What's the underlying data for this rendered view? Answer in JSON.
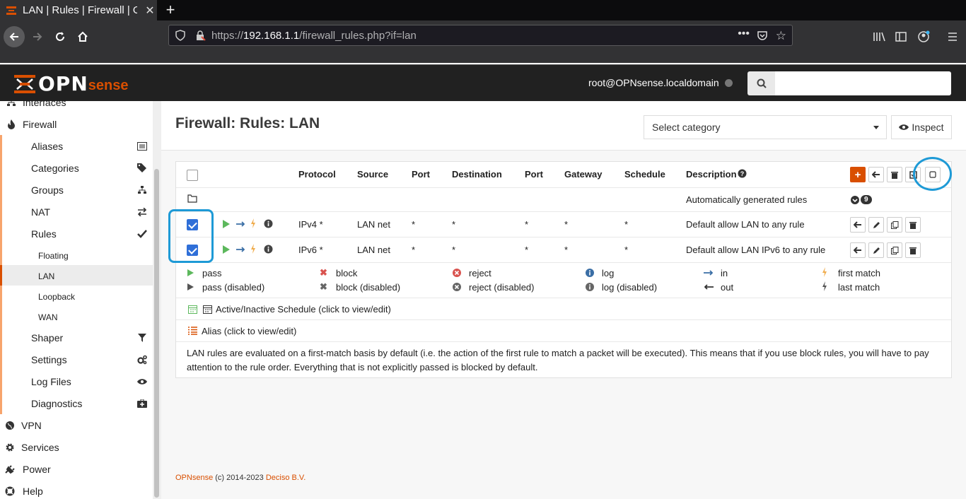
{
  "browser": {
    "tab_title": "LAN | Rules | Firewall | O",
    "url_prefix": "https://",
    "url_host": "192.168.1.1",
    "url_path": "/firewall_rules.php?if=lan"
  },
  "header": {
    "logo_main": "OPN",
    "logo_accent": "sense",
    "user": "root@OPNsense.localdomain",
    "search_placeholder": ""
  },
  "sidebar": {
    "partial_top": "Interfaces",
    "firewall": "Firewall",
    "sub": [
      "Aliases",
      "Categories",
      "Groups",
      "NAT",
      "Rules"
    ],
    "rules_sub": [
      "Floating",
      "LAN",
      "Loopback",
      "WAN"
    ],
    "sub2": [
      "Shaper",
      "Settings",
      "Log Files",
      "Diagnostics"
    ],
    "top": [
      "VPN",
      "Services",
      "Power",
      "Help"
    ]
  },
  "page": {
    "title": "Firewall: Rules: LAN",
    "select_category": "Select category",
    "inspect": "Inspect"
  },
  "table": {
    "columns": [
      "Protocol",
      "Source",
      "Port",
      "Destination",
      "Port",
      "Gateway",
      "Schedule",
      "Description"
    ],
    "auto_rules": {
      "description": "Automatically generated rules",
      "count": "9"
    },
    "rows": [
      {
        "protocol": "IPv4 *",
        "source": "LAN net",
        "sport": "*",
        "dest": "*",
        "dport": "*",
        "gateway": "*",
        "schedule": "*",
        "description": "Default allow LAN to any rule"
      },
      {
        "protocol": "IPv6 *",
        "source": "LAN net",
        "sport": "*",
        "dest": "*",
        "dport": "*",
        "gateway": "*",
        "schedule": "*",
        "description": "Default allow LAN IPv6 to any rule"
      }
    ]
  },
  "legend": {
    "pass": "pass",
    "pass_disabled": "pass (disabled)",
    "block": "block",
    "block_disabled": "block (disabled)",
    "reject": "reject",
    "reject_disabled": "reject (disabled)",
    "log": "log",
    "log_disabled": "log (disabled)",
    "in": "in",
    "out": "out",
    "first_match": "first match",
    "last_match": "last match",
    "schedule": "Active/Inactive Schedule (click to view/edit)",
    "alias": "Alias (click to view/edit)"
  },
  "notice": "LAN rules are evaluated on a first-match basis by default (i.e. the action of the first rule to match a packet will be executed). This means that if you use block rules, you will have to pay attention to the rule order. Everything that is not explicitly passed is blocked by default.",
  "footer": {
    "brand": "OPNsense",
    "middle": "(c) 2014-2023",
    "company": "Deciso B.V."
  },
  "colors": {
    "accent": "#d94f00",
    "pass": "#5cb85c",
    "block": "#d9534f",
    "log": "#3a6ea5",
    "highlight": "#1e9ad6"
  }
}
